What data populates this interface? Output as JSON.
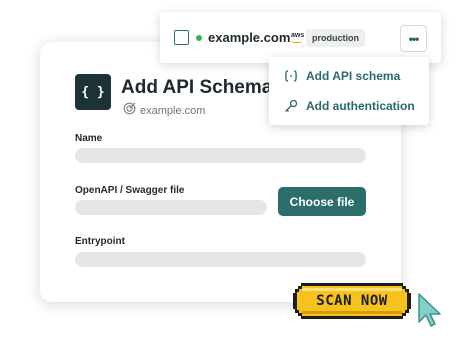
{
  "card": {
    "title": "Add API Schema",
    "app_icon_glyph": "{ }",
    "subtitle": "example.com",
    "subtitle_icon": "scan-target-icon",
    "fields": {
      "name_label": "Name",
      "openapi_label": "OpenAPI / Swagger file",
      "entrypoint_label": "Entrypoint"
    },
    "choose_file_label": "Choose file"
  },
  "topbar": {
    "domain": "example.com",
    "status": "online",
    "cloud_logo_text": "aws",
    "environment": "production",
    "more_label": "•••"
  },
  "dropdown": {
    "items": [
      {
        "label": "Add API schema",
        "icon": "api-braces-icon"
      },
      {
        "label": "Add authentication",
        "icon": "key-icon"
      }
    ]
  },
  "cta": {
    "label": "SCAN NOW"
  },
  "colors": {
    "accent": "#2c6e6c",
    "dark_icon_bg": "#1d3238",
    "status_green": "#37b24d",
    "cta_yellow": "#f6c21c",
    "cursor_teal": "#7fd0c9"
  }
}
